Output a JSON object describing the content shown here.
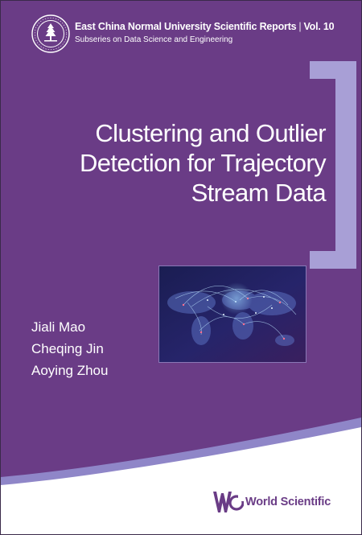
{
  "series": {
    "title": "East China Normal University Scientific Reports",
    "volume": "Vol. 10",
    "subtitle": "Subseries on Data Science and Engineering"
  },
  "book": {
    "title_lines": [
      "Clustering and Outlier",
      "Detection for Trajectory",
      "Stream Data"
    ]
  },
  "authors": [
    "Jiali Mao",
    "Cheqing Jin",
    "Aoying Zhou"
  ],
  "publisher": {
    "name": "World Scientific"
  },
  "colors": {
    "background": "#6a3c86",
    "bracket": "#a89fd6",
    "bottom_panel": "#ffffff",
    "wave_accent": "#8f86c8"
  },
  "icons": {
    "seal": "university-seal-icon",
    "publisher_logo": "world-scientific-logo-icon",
    "cover_image": "world-map-network-image"
  }
}
